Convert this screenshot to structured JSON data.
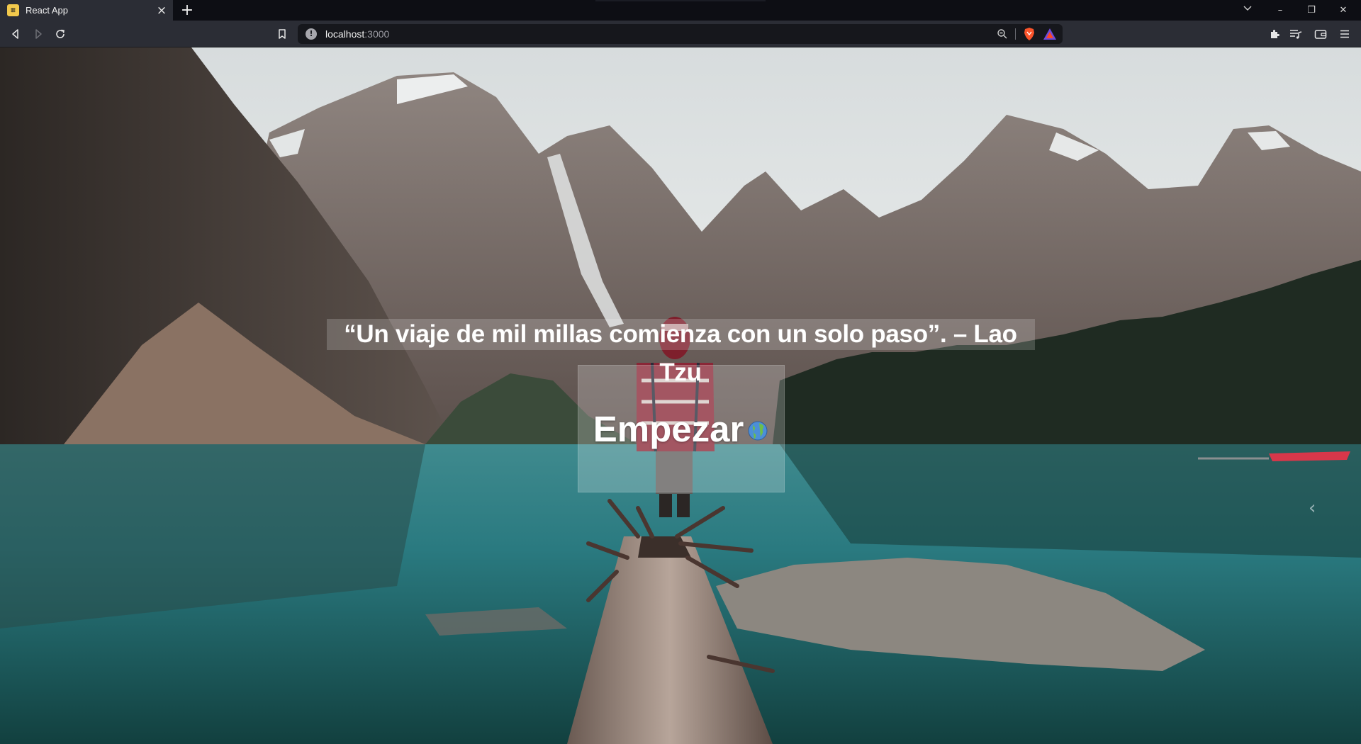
{
  "browser": {
    "tab_title": "React App",
    "favicon_glyph": "⌗",
    "tab_close_glyph": "×",
    "new_tab_glyph": "+",
    "url_host": "localhost",
    "url_port": ":3000",
    "url_info_glyph": "!",
    "window_controls": {
      "minimize": "–",
      "restore": "❐",
      "close": "✕",
      "tab_search": "⌄"
    },
    "icons": [
      "back-icon",
      "forward-icon",
      "reload-icon",
      "bookmark-icon",
      "zoom-icon",
      "brave-shields-icon",
      "brave-rewards-icon",
      "extensions-icon",
      "playlist-icon",
      "wallet-icon",
      "menu-icon"
    ],
    "accent": "#fb542b"
  },
  "page": {
    "quote": "“Un viaje de mil millas comienza con un solo paso”. – Lao Tzu",
    "start_button": "Empezar",
    "carousel_prev_glyph": "‹"
  }
}
